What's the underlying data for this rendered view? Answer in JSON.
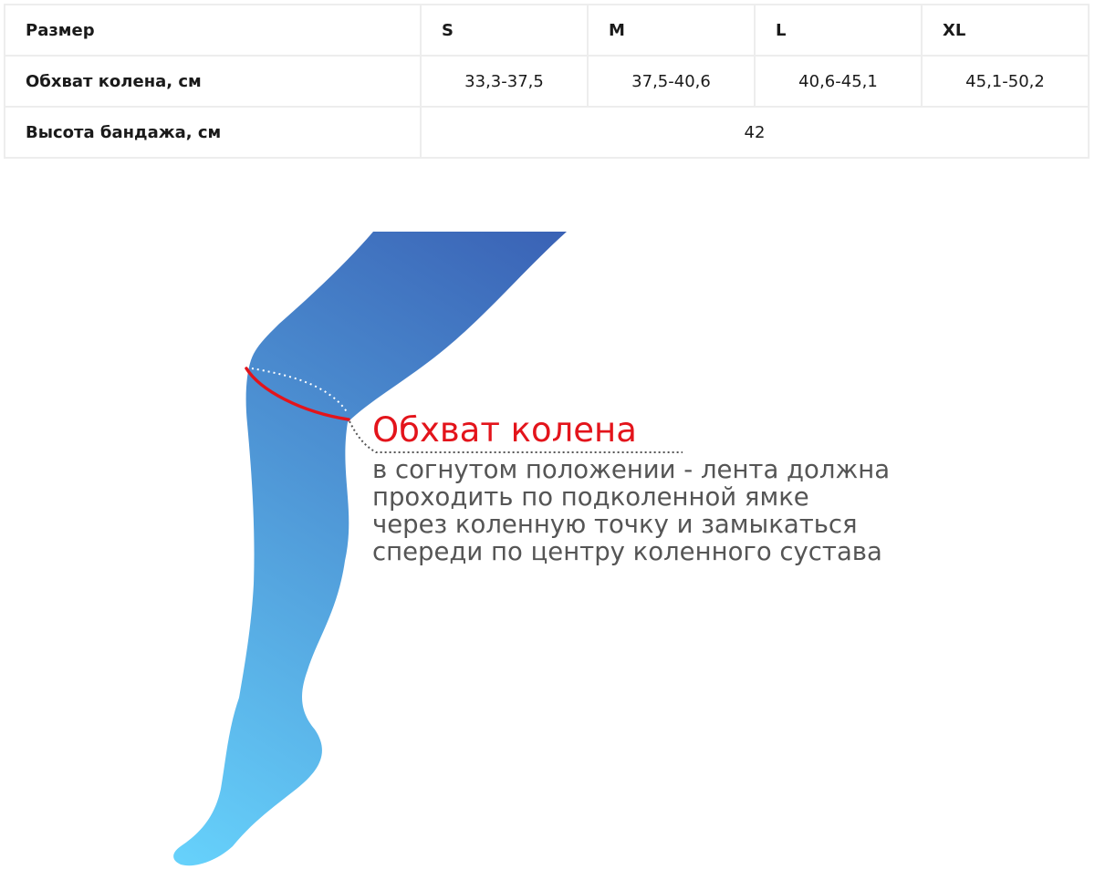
{
  "table": {
    "size_label": "Размер",
    "sizes": [
      "S",
      "M",
      "L",
      "XL"
    ],
    "knee_label": "Обхват колена, см",
    "knee_values": [
      "33,3-37,5",
      "37,5-40,6",
      "40,6-45,1",
      "45,1-50,2"
    ],
    "height_label": "Высота бандажа, см",
    "height_value": "42"
  },
  "diagram": {
    "title": "Обхват колена",
    "lines": [
      "в согнутом положении - лента должна",
      "проходить по подколенной ямке",
      "через коленную точку и замыкаться",
      "спереди по центру коленного сустава"
    ],
    "colors": {
      "leg_top": "#3a62b5",
      "leg_bottom": "#66d1fb",
      "measure_line": "#e3141b",
      "title": "#e3141b",
      "text": "#555555"
    }
  }
}
